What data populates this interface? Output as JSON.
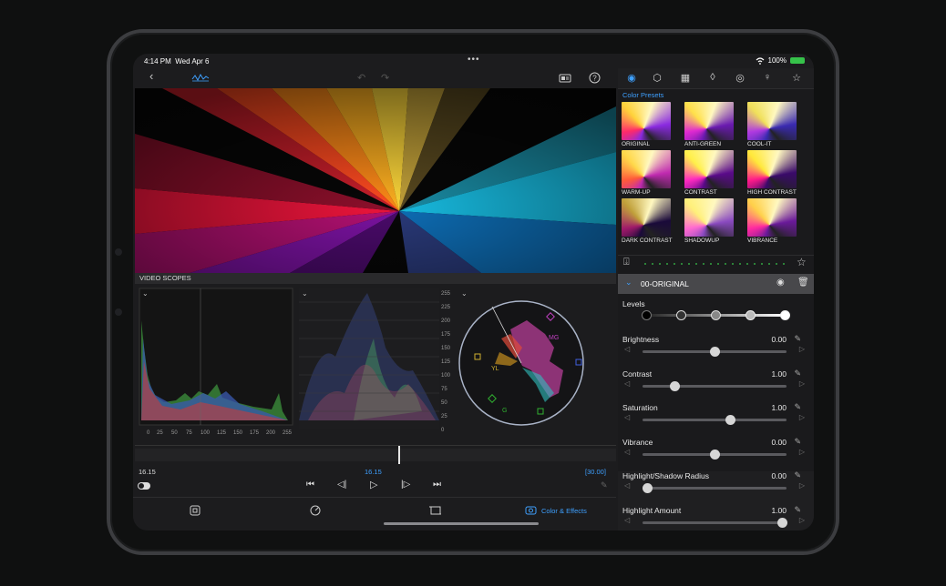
{
  "status": {
    "time": "4:14 PM",
    "date": "Wed Apr 6",
    "battery": "100%",
    "battery_color": "#36c24a"
  },
  "scopes": {
    "header": "VIDEO SCOPES",
    "histogram_ticks": [
      "0",
      "25",
      "50",
      "75",
      "100",
      "125",
      "150",
      "175",
      "200",
      "255"
    ],
    "waveform_ticks": [
      "255",
      "225",
      "200",
      "175",
      "150",
      "125",
      "100",
      "75",
      "50",
      "25",
      "0"
    ],
    "vectorscope_labels": [
      "MG",
      "YL",
      "G"
    ]
  },
  "timeline": {
    "start": "16.15",
    "current": "16.15",
    "fps": "[30.00]",
    "accent": "#3ea0ff"
  },
  "tabbar": {
    "active_label": "Color & Effects"
  },
  "panel": {
    "presets_title": "Color Presets",
    "presets": [
      {
        "label": "ORIGINAL"
      },
      {
        "label": "ANTI-GREEN"
      },
      {
        "label": "COOL-IT"
      },
      {
        "label": "WARM-UP"
      },
      {
        "label": "CONTRAST"
      },
      {
        "label": "HIGH CONTRAST"
      },
      {
        "label": "DARK CONTRAST"
      },
      {
        "label": "SHADOWUP"
      },
      {
        "label": "VIBRANCE"
      }
    ],
    "layer_name": "00-ORIGINAL",
    "levels_label": "Levels",
    "adjustments": [
      {
        "name": "Brightness",
        "value": "0.00",
        "fraction": 0.5
      },
      {
        "name": "Contrast",
        "value": "1.00",
        "fraction": 0.22
      },
      {
        "name": "Saturation",
        "value": "1.00",
        "fraction": 0.61
      },
      {
        "name": "Vibrance",
        "value": "0.00",
        "fraction": 0.5
      },
      {
        "name": "Highlight/Shadow Radius",
        "value": "0.00",
        "fraction": 0.03
      },
      {
        "name": "Highlight Amount",
        "value": "1.00",
        "fraction": 0.97
      }
    ]
  }
}
